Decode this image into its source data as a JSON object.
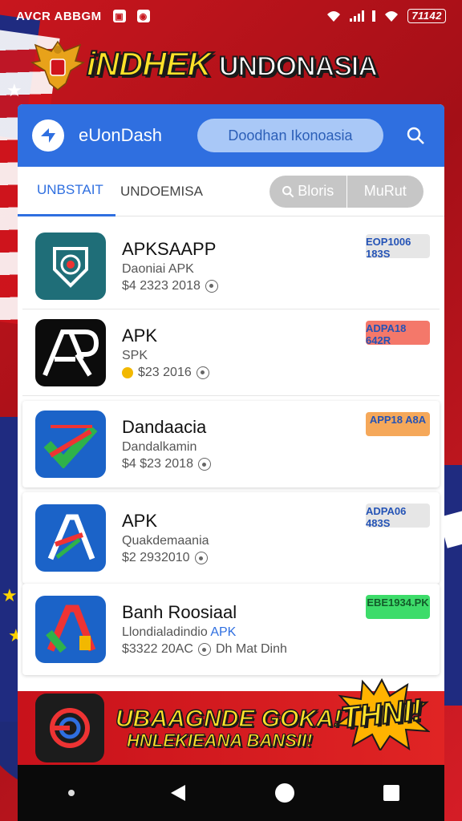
{
  "status_bar": {
    "left_text": "AVCR ABBGM",
    "battery": "71142"
  },
  "banner": {
    "title_part1": "iNDHEK",
    "title_part2": "UNDONASIA"
  },
  "appbar": {
    "title": "eUonDash",
    "search_placeholder": "Doodhan Ikonoasia"
  },
  "tabs": [
    {
      "label": "UNBSTAIT",
      "active": true
    },
    {
      "label": "UNDOEMISA",
      "active": false
    }
  ],
  "segment": {
    "left_label": "Bloris",
    "right_label": "MuRut"
  },
  "apps": [
    {
      "name": "APKSAAPP",
      "sub": "Daoniai APK",
      "meta": "$4 2323 2018",
      "badge_text": "EOP1006 183S",
      "badge_color": "#e6e6e6"
    },
    {
      "name": "APK",
      "sub": "SPK",
      "meta": "$23 2016",
      "badge_text": "ADPA18 642R",
      "badge_color": "#f4786a"
    },
    {
      "name": "Dandaacia",
      "sub": "Dandalkamin",
      "meta": "$4 $23 2018",
      "badge_text": "APP18 A8A",
      "badge_color": "#f5a85a"
    },
    {
      "name": "APK",
      "sub": "Quakdemaania",
      "meta": "$2 2932010",
      "badge_text": "ADPA06 483S",
      "badge_color": "#e6e6e6"
    },
    {
      "name": "Banh Roosiaal",
      "sub": "Llondialadindio",
      "sub_link": "APK",
      "meta": "$3322 20AC",
      "meta_extra": "Dh Mat Dinh",
      "badge_text": "EBE1934.PK",
      "badge_color": "#3ddc6a"
    }
  ],
  "promo": {
    "line1": "UBAAGNDE GOKA!",
    "line2": "HNLEKIEANA BANSII!",
    "burst": "THNI!"
  },
  "colors": {
    "primary": "#2f6fe0",
    "banner_red": "#c8161e",
    "headline_yellow": "#ffe229"
  }
}
